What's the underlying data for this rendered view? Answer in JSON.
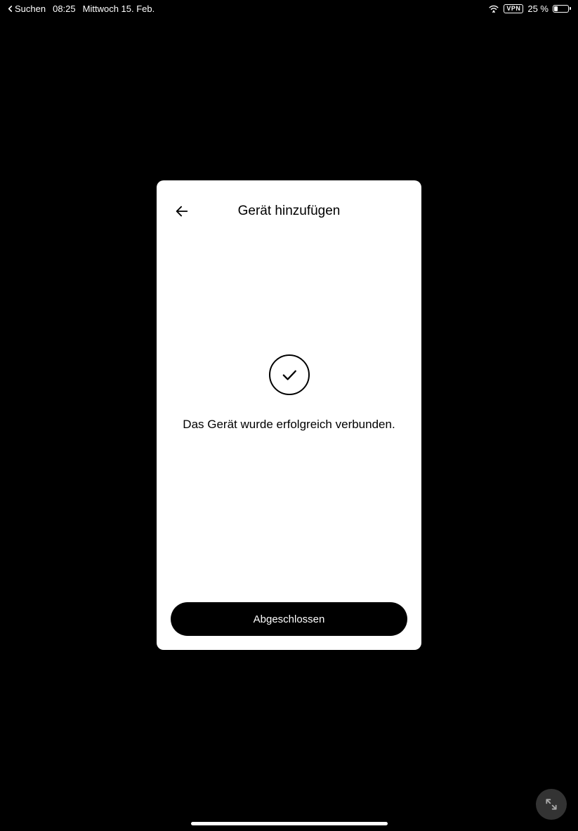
{
  "status": {
    "back_app": "Suchen",
    "time": "08:25",
    "date": "Mittwoch 15. Feb.",
    "vpn": "VPN",
    "battery_pct": "25 %"
  },
  "modal": {
    "title": "Gerät hinzufügen",
    "success_message": "Das Gerät wurde erfolgreich verbunden.",
    "done_button": "Abgeschlossen"
  }
}
